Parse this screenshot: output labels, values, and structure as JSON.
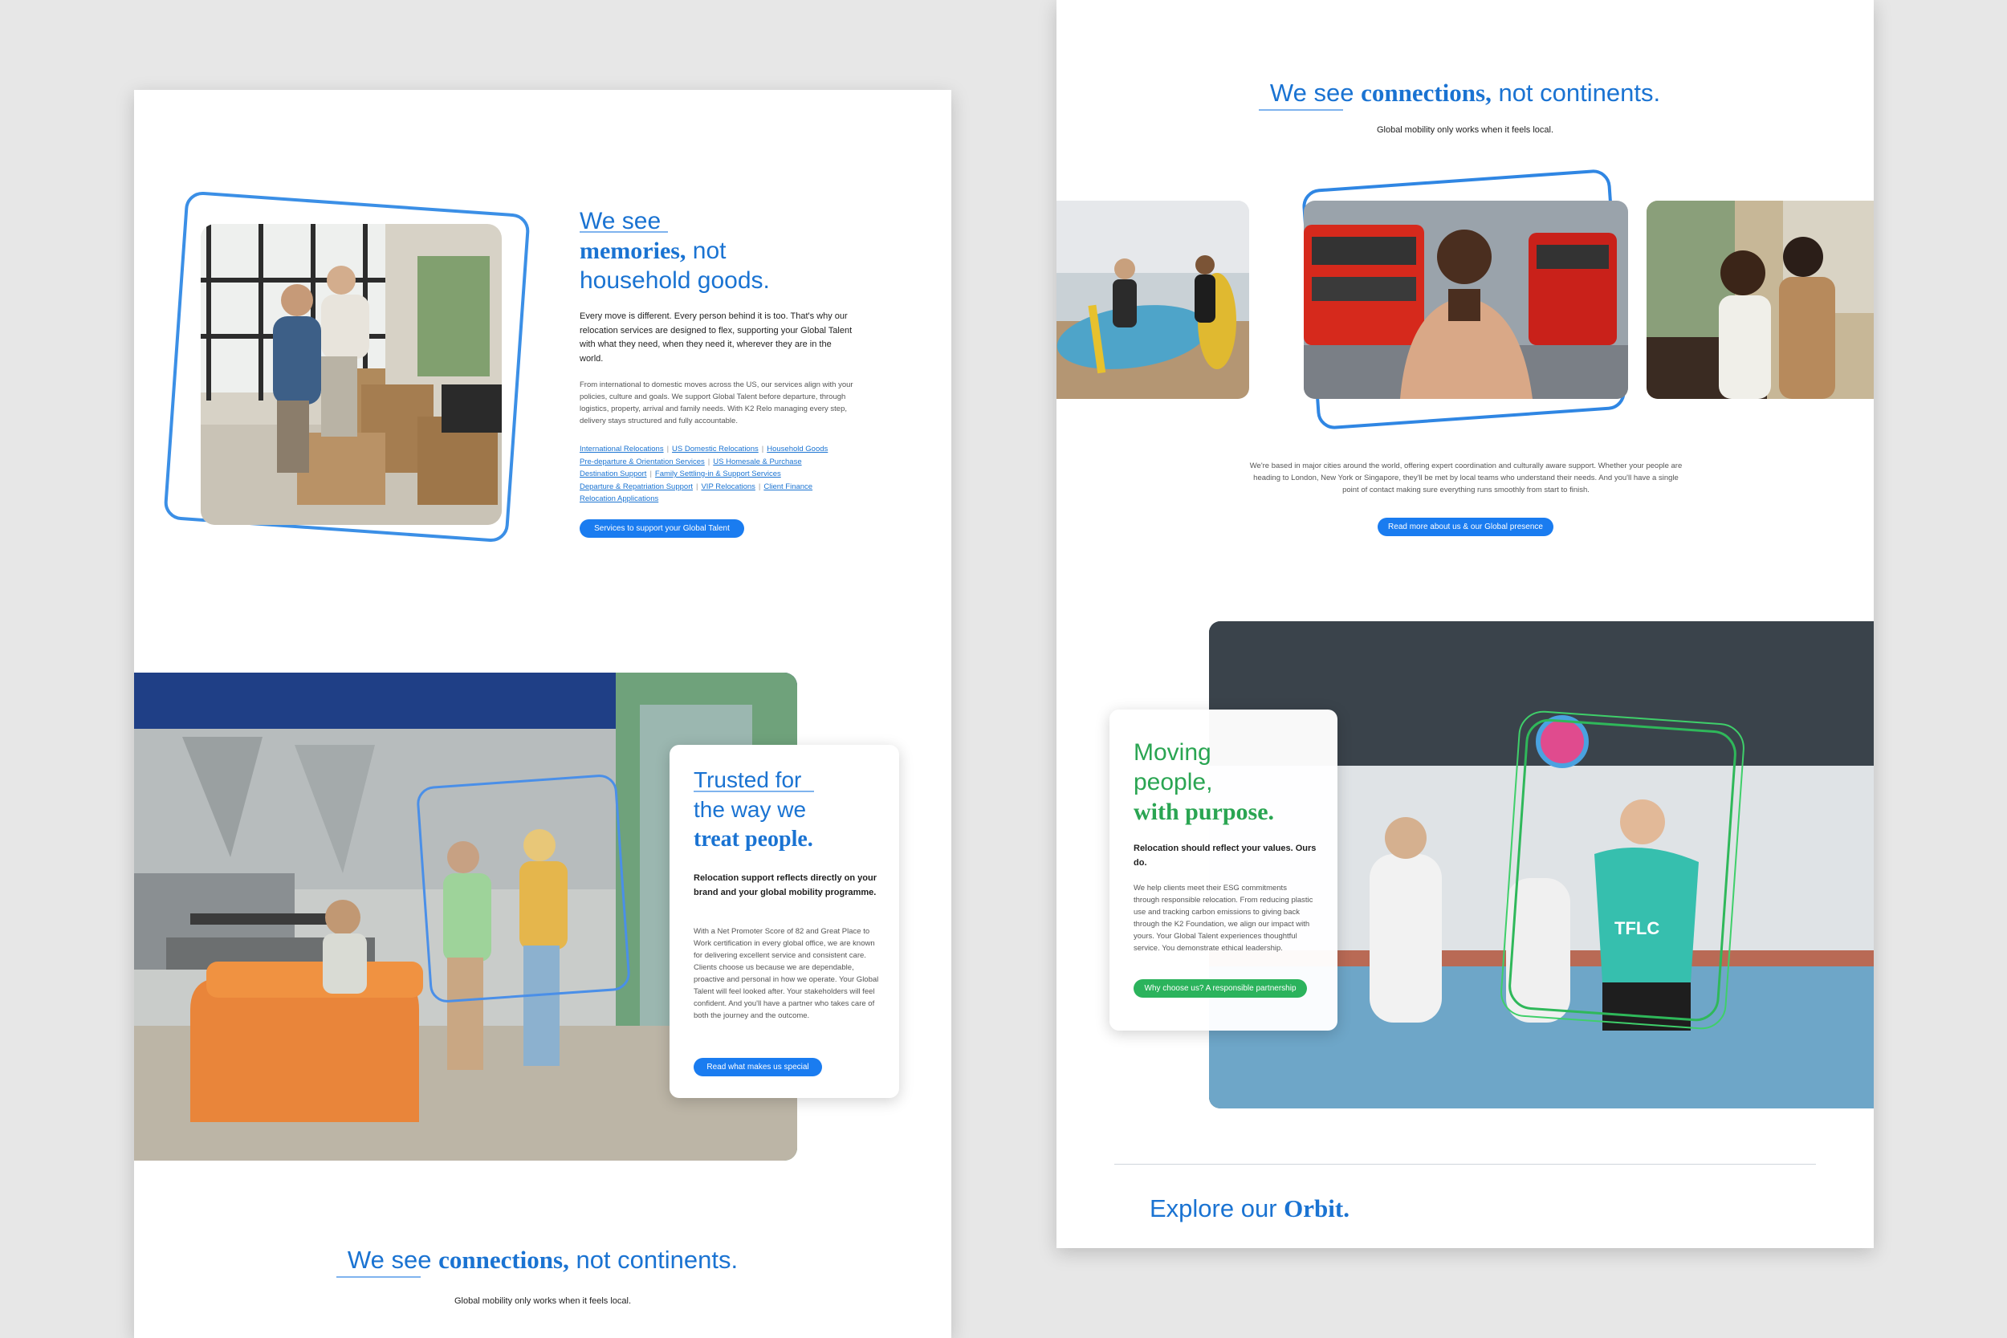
{
  "left": {
    "memories": {
      "heading_line1": "We see",
      "heading_bold": "memories,",
      "heading_rest": " not",
      "heading_line3": "household goods.",
      "lead": "Every move is different. Every person behind it is too. That's why our relocation services are designed to flex, supporting your Global Talent with what they need, when they need it, wherever they are in the world.",
      "body": "From international to domestic moves across the US, our services align with your policies, culture and goals. We support Global Talent before departure, through logistics, property, arrival and family needs. With K2 Relo managing every step, delivery stays structured and fully accountable.",
      "links": [
        "International Relocations",
        "US Domestic Relocations",
        "Household Goods",
        "Pre-departure & Orientation Services",
        "US Homesale & Purchase",
        "Destination Support",
        "Family Settling-in & Support Services",
        "Departure & Repatriation Support",
        "VIP Relocations",
        "Client Finance",
        "Relocation Applications"
      ],
      "button": "Services to support your Global Talent"
    },
    "trusted": {
      "line1": "Trusted for",
      "line2": "the way we",
      "line3": "treat people.",
      "lead": "Relocation support reflects directly on your brand and your global mobility programme.",
      "body": "With a Net Promoter Score of 82 and Great Place to Work certification in every global office, we are known for delivering excellent service and consistent care. Clients choose us because we are dependable, proactive and personal in how we operate. Your Global Talent will feel looked after. Your stakeholders will feel confident. And you'll have a partner who takes care of both the journey and the outcome.",
      "button": "Read what makes us special"
    },
    "connections": {
      "we_see": "We see",
      "bold": "connections,",
      "rest": "not continents.",
      "sub": "Global mobility only works when it feels local."
    }
  },
  "right": {
    "connections": {
      "we_see": "We see",
      "bold": "connections,",
      "rest": "not continents.",
      "sub": "Global mobility only works when it feels local.",
      "body": "We're based in major cities around the world, offering expert coordination and culturally aware support. Whether your people are heading to London, New York or Singapore, they'll be met by local teams who understand their needs. And you'll have a single point of contact making sure everything runs smoothly from start to finish.",
      "button": "Read more about us & our Global presence"
    },
    "purpose": {
      "line1": "Moving",
      "line2": "people,",
      "line3": "with purpose.",
      "lead": "Relocation should reflect your values. Ours do.",
      "body": "We help clients meet their ESG commitments through responsible relocation. From reducing plastic use and tracking carbon emissions to giving back through the K2 Foundation, we align our impact with yours. Your Global Talent experiences thoughtful service. You demonstrate ethical leadership.",
      "button": "Why choose us? A responsible partnership",
      "shirt_text": "TFLC"
    },
    "orbit": {
      "explore": "Explore our",
      "bold": "Orbit."
    }
  },
  "colors": {
    "blue": "#1a73d2",
    "button_blue": "#1a7cf0",
    "green": "#2bb35c",
    "background": "#e7e7e7"
  }
}
